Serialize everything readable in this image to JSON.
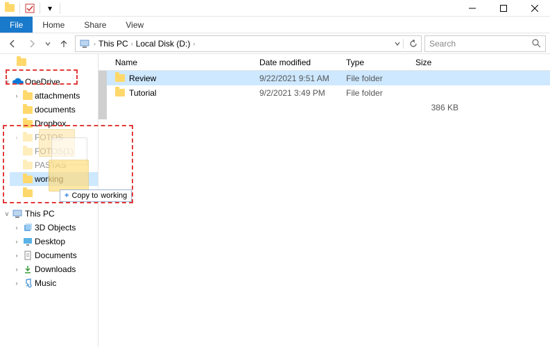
{
  "title_bar": {
    "chevron": "▾"
  },
  "ribbon": {
    "file": "File",
    "tabs": [
      "Home",
      "Share",
      "View"
    ]
  },
  "address": {
    "crumbs": [
      "This PC",
      "Local Disk (D:)"
    ],
    "search_placeholder": "Search"
  },
  "tree": {
    "onedrive": "OneDrive",
    "onedrive_children": [
      "attachments",
      "documents",
      "Dropbox",
      "FOTOS",
      "FOTOS(1)",
      "PASTAS",
      "working"
    ],
    "this_pc": "This PC",
    "pc_children": [
      "3D Objects",
      "Desktop",
      "Documents",
      "Downloads",
      "Music"
    ]
  },
  "columns": {
    "name": "Name",
    "date": "Date modified",
    "type": "Type",
    "size": "Size"
  },
  "files": [
    {
      "name": "Review",
      "date": "9/22/2021 9:51 AM",
      "type": "File folder",
      "size": ""
    },
    {
      "name": "Tutorial",
      "date": "9/2/2021 3:49 PM",
      "type": "File folder",
      "size": ""
    }
  ],
  "status": {
    "total_size": "386 KB"
  },
  "drop_tip": {
    "action": "Copy to",
    "target": "working"
  }
}
